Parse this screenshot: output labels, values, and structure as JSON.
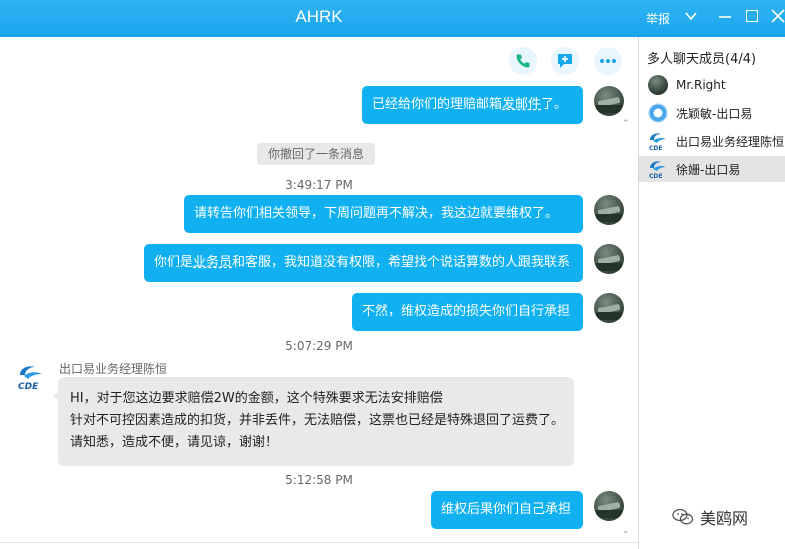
{
  "window": {
    "title": "AHRK",
    "report_label": "举报"
  },
  "sidebar": {
    "title": "多人聊天成员(4/4)",
    "members": [
      {
        "name": "Mr.Right"
      },
      {
        "name": "冼颖敏-出口易"
      },
      {
        "name": "出口易业务经理陈恒"
      },
      {
        "name": "徐姗-出口易"
      }
    ]
  },
  "chat": {
    "msg1_a": "已经给你们的理赔邮箱",
    "msg1_b": "发邮件",
    "msg1_c": "了。",
    "recall_notice": "你撤回了一条消息",
    "time1": "3:49:17 PM",
    "msg2": "请转告你们相关领导，下周问题再不解决，我这边就要维权了。",
    "msg3_a": "你们是",
    "msg3_b": "业务员",
    "msg3_c": "和客服，我知道没有权限，希望找个说话算数的人跟我联系",
    "msg4": "不然，维权造成的损失你们自行承担",
    "time2": "5:07:29 PM",
    "sender_name": "出口易业务经理陈恒",
    "reply_lines": [
      "HI，对于您这边要求赔偿2W的金额，这个特殊要求无法安排赔偿",
      "针对不可控因素造成的扣货，并非丢件，无法赔偿，这票也已经是特殊退回了运费了。",
      "请知悉，造成不便，请见谅，谢谢！"
    ],
    "time3": "5:12:58 PM",
    "msg5": "维权后果你们自己承担"
  },
  "watermark": {
    "text": "美鸥网"
  },
  "colors": {
    "titlebar": "#1aa5ec",
    "bubble_outgoing": "#11b1f1",
    "bubble_incoming": "#e9e9e9",
    "selected_row": "#e4e4e4"
  }
}
